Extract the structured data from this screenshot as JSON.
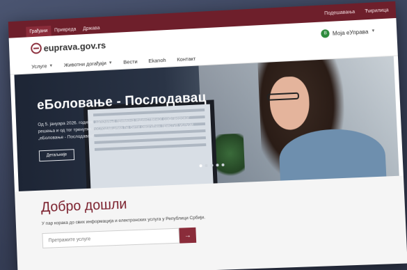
{
  "topbar": {
    "tabs": [
      "Грађани",
      "Привреда",
      "Државa"
    ],
    "links": [
      "Подешавања",
      "Ћирилица"
    ]
  },
  "header": {
    "logo": "euprava.gov.rs",
    "account_label": "Моја eУправа",
    "avatar_initial": "В"
  },
  "nav": {
    "items": [
      "Услуге",
      "Животни догађаји",
      "Вести",
      "Ekanoh",
      "Контакт"
    ]
  },
  "hero": {
    "title": "еБоловање - Послодавац",
    "text": "Од 5. јануара 2026. године, започиње примена јединственог софтверског решења и од тог тренутка послодавцима ће бити омогућен приступ услузи „еБоловање - Послодавац“.",
    "button": "Детаљније"
  },
  "welcome": {
    "title": "Добро дошли",
    "subtitle": "У пар корака до свих информација и електронских услуга у Републици Србији.",
    "search_placeholder": "Претражите услуге"
  }
}
